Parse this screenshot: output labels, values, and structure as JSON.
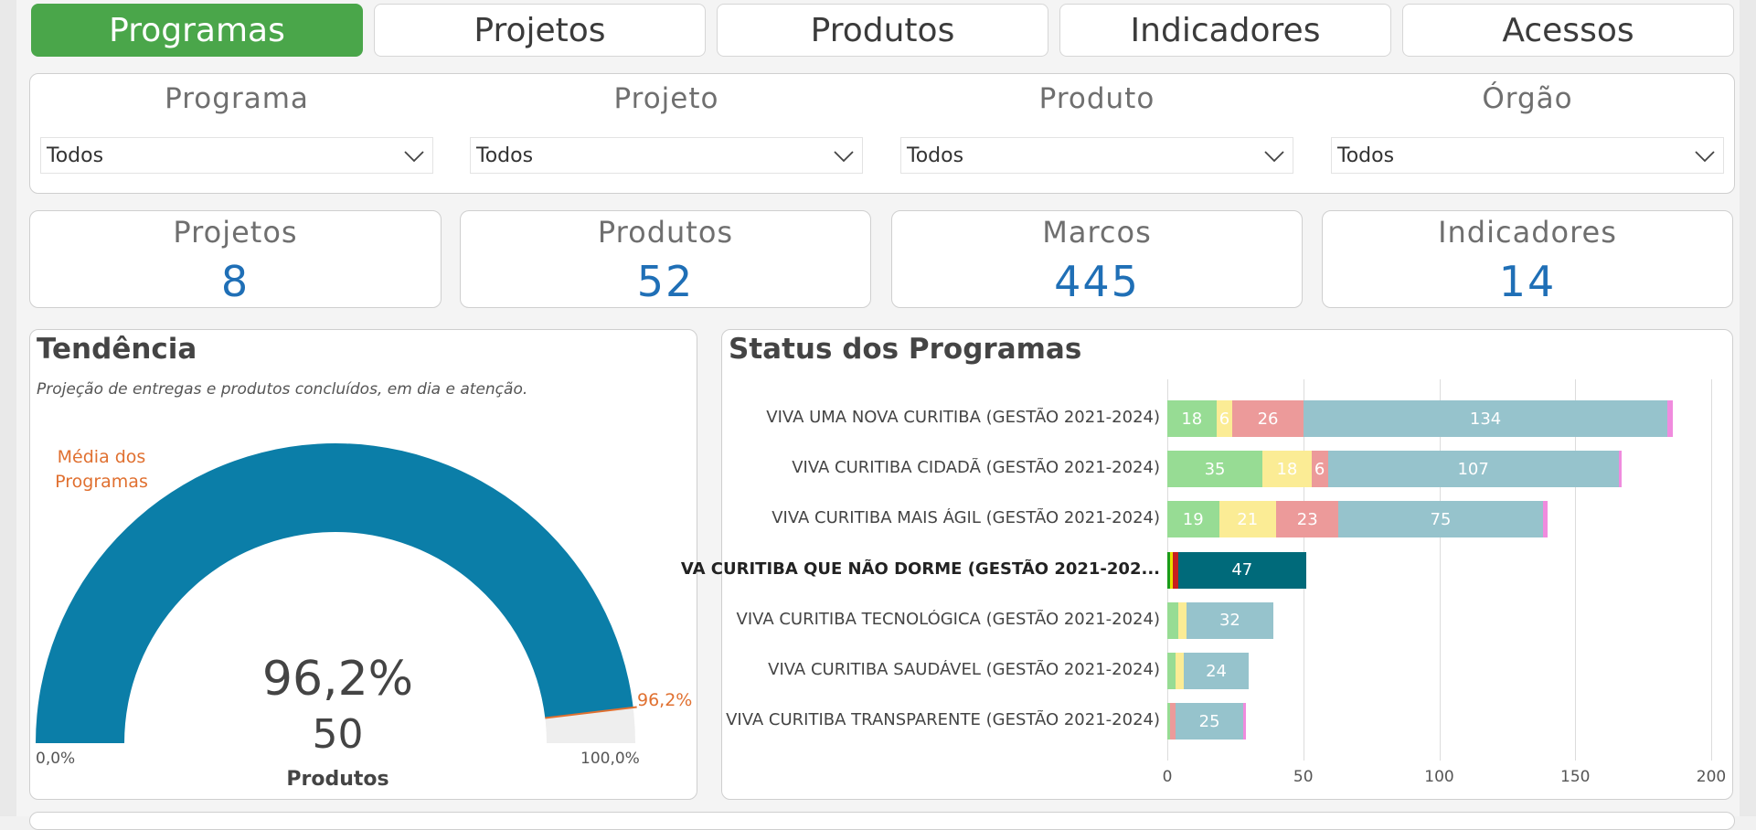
{
  "tabs": [
    "Programas",
    "Projetos",
    "Produtos",
    "Indicadores",
    "Acessos"
  ],
  "filters": [
    {
      "label": "Programa",
      "value": "Todos"
    },
    {
      "label": "Projeto",
      "value": "Todos"
    },
    {
      "label": "Produto",
      "value": "Todos"
    },
    {
      "label": "Órgão",
      "value": "Todos"
    }
  ],
  "kpis": [
    {
      "label": "Projetos",
      "value": "8"
    },
    {
      "label": "Produtos",
      "value": "52"
    },
    {
      "label": "Marcos",
      "value": "445"
    },
    {
      "label": "Indicadores",
      "value": "14"
    }
  ],
  "trend": {
    "title": "Tendência",
    "subtitle": "Projeção de entregas e produtos concluídos, em dia e atenção.",
    "target_label": "Média dos Programas",
    "target_label_line1": "Média dos",
    "target_label_line2": "Programas",
    "percent": "96,2%",
    "target_value": "96,2%",
    "count": "50",
    "count_label": "Produtos",
    "min_label": "0,0%",
    "max_label": "100,0%",
    "gauge_fraction": 0.962,
    "gauge_color": "#0b7ea8"
  },
  "status": {
    "title": "Status dos Programas",
    "colors": {
      "green": "#97dc94",
      "yellow": "#fbec95",
      "red": "#ec9a9a",
      "teal": "#96c3cc",
      "pink": "#f08bde",
      "dark_green": "#1a9c1a",
      "dark_yellow": "#e8e000",
      "dark_red": "#c81e1e",
      "dark_teal": "#006a7a"
    }
  },
  "chart_data": {
    "type": "bar",
    "orientation": "horizontal",
    "stacked": true,
    "categories": [
      "VIVA UMA NOVA CURITIBA (GESTÃO 2021-2024)",
      "VIVA CURITIBA CIDADÃ (GESTÃO 2021-2024)",
      "VIVA CURITIBA MAIS ÁGIL (GESTÃO 2021-2024)",
      "VA CURITIBA QUE NÃO DORME (GESTÃO 2021-202...",
      "VIVA CURITIBA TECNOLÓGICA (GESTÃO 2021-2024)",
      "VIVA CURITIBA SAUDÁVEL (GESTÃO 2021-2024)",
      "VIVA CURITIBA TRANSPARENTE (GESTÃO 2021-2024)"
    ],
    "highlighted_index": 3,
    "series": [
      {
        "values": [
          18,
          35,
          19,
          1,
          4,
          3,
          1
        ],
        "color": "green"
      },
      {
        "values": [
          6,
          18,
          21,
          1,
          3,
          3,
          0
        ],
        "color": "yellow"
      },
      {
        "values": [
          26,
          6,
          23,
          2,
          0,
          0,
          2
        ],
        "color": "red"
      },
      {
        "values": [
          134,
          107,
          75,
          47,
          32,
          24,
          25
        ],
        "color": "teal"
      },
      {
        "values": [
          2,
          1,
          2,
          0,
          0,
          0,
          1
        ],
        "color": "pink"
      }
    ],
    "xticks": [
      0,
      50,
      100,
      150,
      200
    ],
    "xlim": [
      0,
      200
    ]
  }
}
